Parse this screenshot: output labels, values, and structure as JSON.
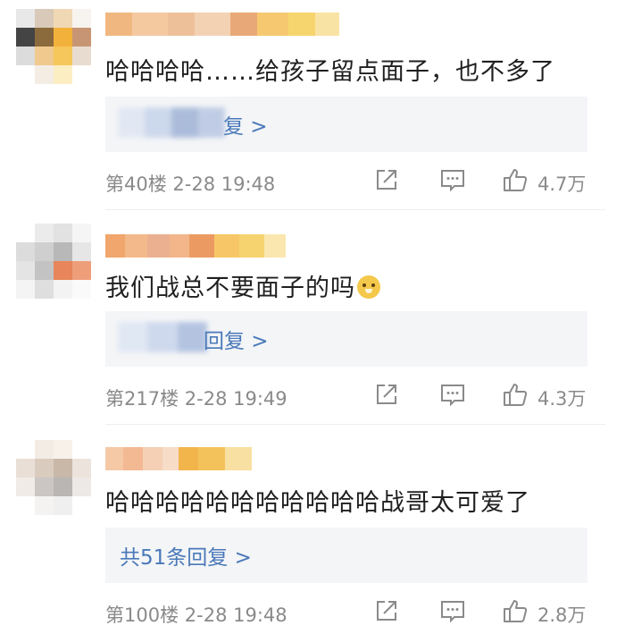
{
  "comments": [
    {
      "text": "哈哈哈哈……给孩子留点面子，也不多了",
      "reply_text": "复 >",
      "floor": "第40楼",
      "time": "2-28 19:48",
      "likes": "4.7万"
    },
    {
      "text": "我们战总不要面子的吗",
      "reply_text": "回复 >",
      "floor": "第217楼",
      "time": "2-28 19:49",
      "likes": "4.3万"
    },
    {
      "text": "哈哈哈哈哈哈哈哈哈哈哈战哥太可爱了",
      "reply_text": "共51条回复 >",
      "floor": "第100楼",
      "time": "2-28 19:48",
      "likes": "2.8万"
    }
  ],
  "colors": {
    "link": "#4a79b9",
    "meta": "#8a8a8a",
    "reply_bg": "#f4f5f7"
  },
  "icons": [
    "share-icon",
    "comment-icon",
    "like-icon"
  ]
}
